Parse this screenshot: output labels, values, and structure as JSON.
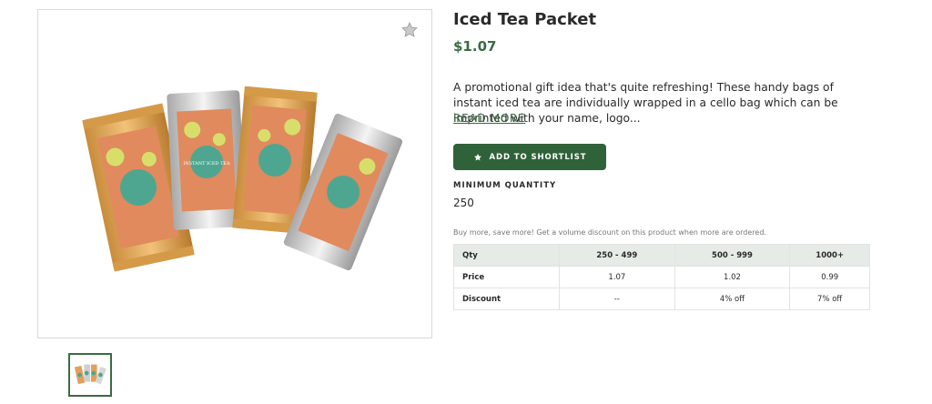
{
  "product": {
    "title": "Iced Tea Packet",
    "price": "$1.07",
    "description": "A promotional gift idea that's quite refreshing! These handy bags of instant iced tea are individually wrapped in a cello bag which can be imprinted with your name, logo...",
    "read_more": "READ MORE",
    "packet_print": "INSTANT ICED TEA"
  },
  "actions": {
    "shortlist_label": "ADD TO SHORTLIST",
    "favorite_icon": "star-icon"
  },
  "minimum": {
    "label": "MINIMUM QUANTITY",
    "value": "250"
  },
  "pricing": {
    "promo": "Buy more, save more! Get a volume discount on this product when more are ordered.",
    "headers": [
      "Qty",
      "250 - 499",
      "500 - 999",
      "1000+"
    ],
    "rows": [
      [
        "Price",
        "1.07",
        "1.02",
        "0.99"
      ],
      [
        "Discount",
        "--",
        "4% off",
        "7% off"
      ]
    ]
  },
  "colors": {
    "accent": "#2f6238",
    "price": "#3a6b41",
    "table_header": "#e6ebe7"
  }
}
